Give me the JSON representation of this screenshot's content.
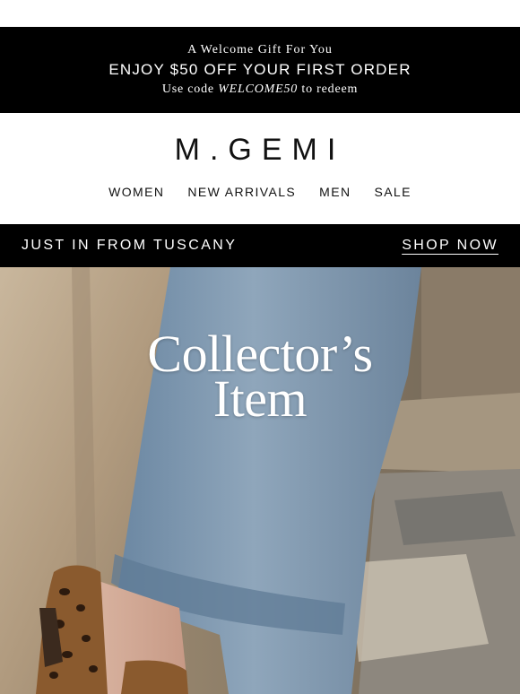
{
  "promo": {
    "intro": "A Welcome Gift For You",
    "offer": "ENJOY $50 OFF YOUR FIRST ORDER",
    "code_prefix": "Use code ",
    "code": "WELCOME50",
    "code_suffix": " to redeem"
  },
  "header": {
    "logo": "M.GEMI",
    "nav": [
      "WOMEN",
      "NEW ARRIVALS",
      "MEN",
      "SALE"
    ]
  },
  "banner": {
    "label": "JUST IN FROM TUSCANY",
    "cta": "SHOP NOW"
  },
  "hero": {
    "title_line1": "Collector’s",
    "title_line2": "Item"
  },
  "colors": {
    "background": "#ffffff",
    "bar": "#000000",
    "text_on_dark": "#ffffff",
    "denim": "#7d96ad"
  }
}
